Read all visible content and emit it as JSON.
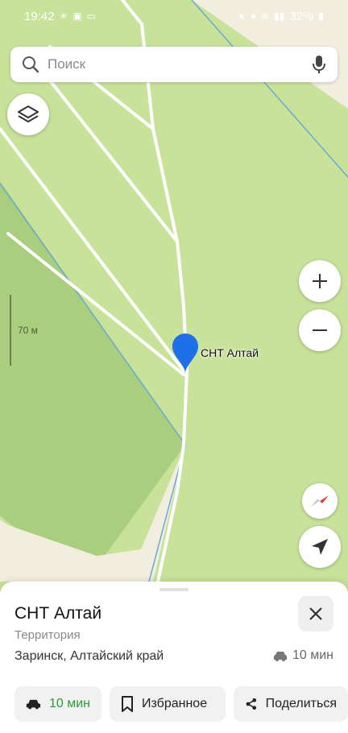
{
  "status_bar": {
    "time": "19:42",
    "battery": "32%"
  },
  "search": {
    "placeholder": "Поиск"
  },
  "map": {
    "scale_label": "70 м",
    "pin_label": "СНТ Алтай",
    "colors": {
      "meadow": "#c8e29a",
      "forest": "#a9cf7e",
      "sand": "#f2eedf",
      "water_line": "#6aa9d6",
      "road": "#ffffff",
      "pin": "#1e6fe8"
    }
  },
  "controls": {
    "layers": "layers-icon",
    "zoom_in": "plus-icon",
    "zoom_out": "minus-icon",
    "compass": "compass-icon",
    "locate": "navigation-arrow-icon"
  },
  "place": {
    "name": "СНТ Алтай",
    "type": "Территория",
    "address": "Заринск, Алтайский край",
    "travel_time": "10 мин"
  },
  "actions": {
    "route_label": "10 мин",
    "favorite_label": "Избранное",
    "share_label": "Поделиться"
  }
}
